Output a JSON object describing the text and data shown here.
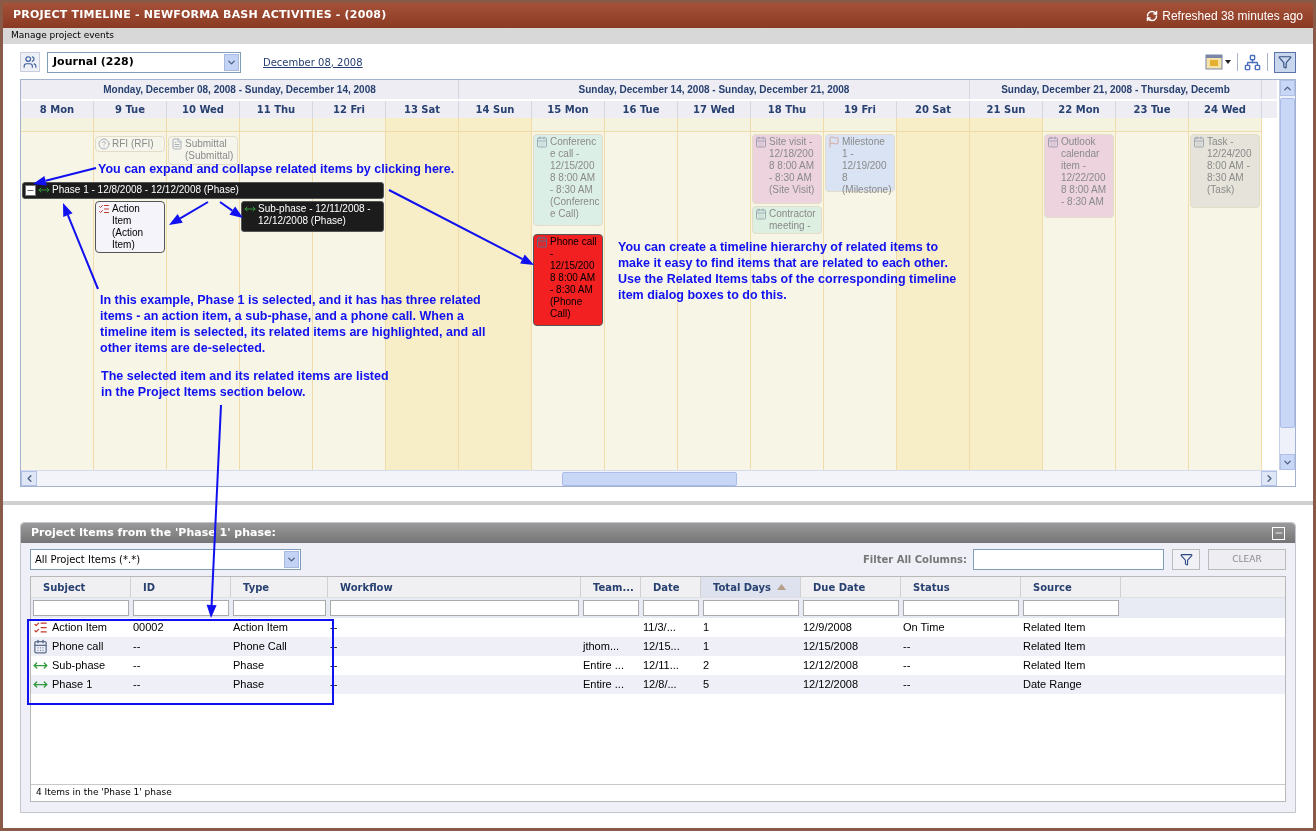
{
  "window": {
    "title": "PROJECT TIMELINE - NEWFORMA BASH ACTIVITIES - (2008)",
    "refreshed": "Refreshed 38 minutes ago"
  },
  "subtitle": "Manage project events",
  "toolbar": {
    "view": "Journal (228)",
    "date_link": "December 08, 2008",
    "filter_pressed": true
  },
  "timeline": {
    "weeks": [
      {
        "label": "Monday, December 08, 2008 - Sunday, December 14, 2008",
        "days": [
          {
            "label": "8 Mon",
            "weekend": false
          },
          {
            "label": "9 Tue",
            "weekend": false
          },
          {
            "label": "10 Wed",
            "weekend": false
          },
          {
            "label": "11 Thu",
            "weekend": false
          },
          {
            "label": "12 Fri",
            "weekend": false
          },
          {
            "label": "13 Sat",
            "weekend": true
          }
        ]
      },
      {
        "label": "Sunday, December 14, 2008 - Sunday, December 21, 2008",
        "days": [
          {
            "label": "14 Sun",
            "weekend": true
          },
          {
            "label": "15 Mon",
            "weekend": false
          },
          {
            "label": "16 Tue",
            "weekend": false
          },
          {
            "label": "17 Wed",
            "weekend": false
          },
          {
            "label": "18 Thu",
            "weekend": false
          },
          {
            "label": "19 Fri",
            "weekend": false
          },
          {
            "label": "20 Sat",
            "weekend": true
          }
        ]
      },
      {
        "label": "Sunday, December 21, 2008 - Thursday, Decemb",
        "days": [
          {
            "label": "21 Sun",
            "weekend": true
          },
          {
            "label": "22 Mon",
            "weekend": false
          },
          {
            "label": "23 Tue",
            "weekend": false
          },
          {
            "label": "24 Wed",
            "weekend": false
          }
        ]
      }
    ],
    "events": [
      {
        "text": "RFI (RFI)",
        "kind": "appointment",
        "highlighted": false,
        "color": "#f6f5ec"
      },
      {
        "text": "Submittal (Submittal)",
        "kind": "appointment",
        "highlighted": false,
        "color": "#f6f5ec"
      },
      {
        "text": "Phase 1 - 12/8/2008 - 12/12/2008 (Phase)",
        "kind": "phase",
        "highlighted": true,
        "expanded": true,
        "color": "#1c1c1c"
      },
      {
        "text": "Action Item (Action Item)",
        "kind": "appointment",
        "highlighted": true,
        "color": "#f4f4fa"
      },
      {
        "text": "Sub-phase - 12/11/2008 - 12/12/2008 (Phase)",
        "kind": "phase",
        "highlighted": true,
        "color": "#1c1c1c"
      },
      {
        "text": "Conference call - 12/15/2008 8:00 AM - 8:30 AM (Conference Call)",
        "kind": "appointment",
        "highlighted": false,
        "color": "#dcefe6"
      },
      {
        "text": "Site visit - 12/18/2008 8:00 AM - 8:30 AM (Site Visit)",
        "kind": "appointment",
        "highlighted": false,
        "color": "#ecd3de"
      },
      {
        "text": "Milestone 1 - 12/19/2008 (Milestone)",
        "kind": "appointment",
        "highlighted": false,
        "color": "#d9e3f4"
      },
      {
        "text": "Contractor meeting -",
        "kind": "appointment",
        "highlighted": false,
        "color": "#dcefe0"
      },
      {
        "text": "Outlook calendar item - 12/22/2008 8:00 AM - 8:30 AM",
        "kind": "appointment",
        "highlighted": false,
        "color": "#ecd3de"
      },
      {
        "text": "Task - 12/24/200 8:00 AM - 8:30 AM (Task)",
        "kind": "appointment",
        "highlighted": false,
        "color": "#e6e4da"
      },
      {
        "text": "Phone call - 12/15/2008 8:00 AM - 8:30 AM (Phone Call)",
        "kind": "appointment",
        "highlighted": true,
        "color": "#f22020"
      }
    ]
  },
  "annotations": [
    "You can expand and collapse related items by clicking here.",
    "You can create a timeline hierarchy of related items to make it easy to find items that are related to each other. Use the Related Items tabs of the corresponding timeline item dialog boxes to do this.",
    "In this example, Phase 1 is selected, and it has has three related items - an action item, a sub-phase, and a phone call. When a timeline item is selected, its related items are highlighted, and all other items are de-selected.",
    "The selected item and its related items are listed in the Project Items section below."
  ],
  "project_items": {
    "title": "Project Items from the 'Phase 1' phase:",
    "filter_select": "All Project Items (*.*)",
    "filter_label": "Filter All Columns:",
    "clear_button": "CLEAR",
    "clear_disabled": true,
    "columns": [
      {
        "label": "Subject",
        "sorted": false
      },
      {
        "label": "ID",
        "sorted": false
      },
      {
        "label": "Type",
        "sorted": false
      },
      {
        "label": "Workflow",
        "sorted": false
      },
      {
        "label": "Team...",
        "sorted": false
      },
      {
        "label": "Date",
        "sorted": false
      },
      {
        "label": "Total Days",
        "sorted": true
      },
      {
        "label": "Due Date",
        "sorted": false
      },
      {
        "label": "Status",
        "sorted": false
      },
      {
        "label": "Source",
        "sorted": false
      }
    ],
    "rows": [
      {
        "cells": [
          "Action Item",
          "00002",
          "Action Item",
          "--",
          "",
          "11/3/...",
          "1",
          "12/9/2008",
          "On Time",
          "Related Item"
        ]
      },
      {
        "cells": [
          "Phone call",
          "--",
          "Phone Call",
          "--",
          "jthom...",
          "12/15...",
          "1",
          "12/15/2008",
          "--",
          "Related Item"
        ]
      },
      {
        "cells": [
          "Sub-phase",
          "--",
          "Phase",
          "--",
          "Entire ...",
          "12/11...",
          "2",
          "12/12/2008",
          "--",
          "Related Item"
        ]
      },
      {
        "cells": [
          "Phase 1",
          "--",
          "Phase",
          "--",
          "Entire ...",
          "12/8/...",
          "5",
          "12/12/2008",
          "--",
          "Date Range"
        ]
      }
    ],
    "footer": "4 Items in the 'Phase 1' phase"
  }
}
